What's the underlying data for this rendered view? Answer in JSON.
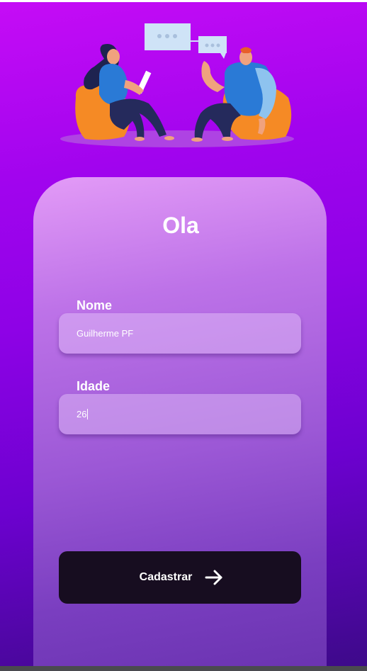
{
  "header": {
    "title": "Ola",
    "illustration": "two-people-chatting-illustration"
  },
  "form": {
    "fields": [
      {
        "label": "Nome",
        "value": "Guilherme PF"
      },
      {
        "label": "Idade",
        "value": "26"
      }
    ],
    "submit": {
      "label": "Cadastrar",
      "icon": "arrow-right-icon"
    }
  },
  "colors": {
    "background_top": "#c60cf6",
    "background_bottom": "#3c0a88",
    "card_top": "#e39bf7",
    "card_bottom": "#6a33b0",
    "button": "#170d20",
    "text": "#ffffff"
  }
}
